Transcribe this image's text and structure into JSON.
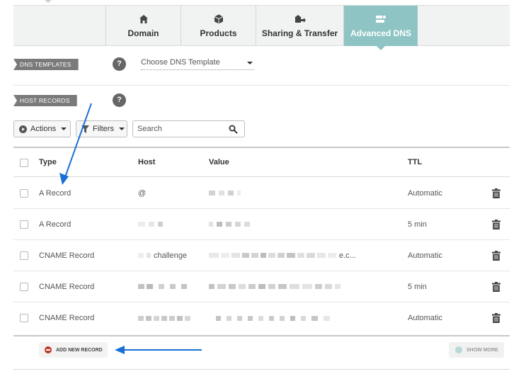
{
  "tabs": [
    {
      "label": "Domain",
      "icon": "home-icon"
    },
    {
      "label": "Products",
      "icon": "box-icon"
    },
    {
      "label": "Sharing & Transfer",
      "icon": "transfer-icon"
    },
    {
      "label": "Advanced DNS",
      "icon": "dns-icon",
      "active": true
    }
  ],
  "dns_templates": {
    "label": "DNS TEMPLATES",
    "help": "?",
    "select_value": "Choose DNS Template"
  },
  "host_records": {
    "label": "HOST RECORDS",
    "help": "?"
  },
  "toolbar": {
    "actions_label": "Actions",
    "filters_label": "Filters",
    "search_placeholder": "Search"
  },
  "table": {
    "headers": {
      "type": "Type",
      "host": "Host",
      "value": "Value",
      "ttl": "TTL"
    },
    "rows": [
      {
        "type": "A Record",
        "host": "@",
        "value": "",
        "ttl": "Automatic"
      },
      {
        "type": "A Record",
        "host": "",
        "value": "",
        "ttl": "5 min"
      },
      {
        "type": "CNAME Record",
        "host": "challenge",
        "value": "e.c...",
        "ttl": "Automatic"
      },
      {
        "type": "CNAME Record",
        "host": "",
        "value": "",
        "ttl": "5 min"
      },
      {
        "type": "CNAME Record",
        "host": "",
        "value": "",
        "ttl": "Automatic"
      }
    ]
  },
  "footer": {
    "add_label": "ADD NEW RECORD",
    "show_more_label": "SHOW MORE"
  },
  "colors": {
    "active_tab": "#8fc4c5",
    "annotation_arrow": "#1a6fd4",
    "add_icon": "#c0392b"
  }
}
